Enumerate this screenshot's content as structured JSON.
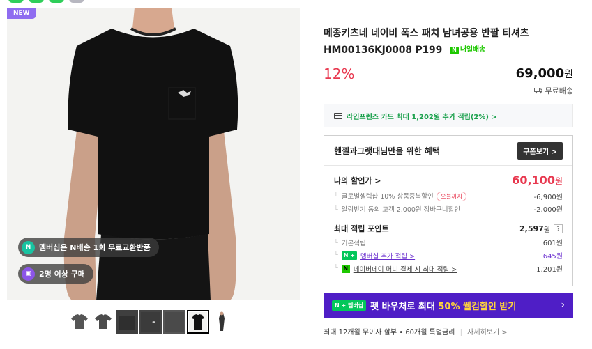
{
  "top_icons": [
    "#2fce5a",
    "#2fce5a",
    "#2fce5a",
    "#b7b7c0"
  ],
  "gallery": {
    "new_badge": "NEW",
    "chips": [
      {
        "icon": "n-exchange-icon",
        "label": "멤버십은 N배송 1회 무료교환반품"
      },
      {
        "icon": "bag-icon",
        "label": "2명 이상 구매"
      }
    ],
    "thumbnails_count": 7,
    "selected_thumbnail": 6
  },
  "product": {
    "title": "메종키츠네 네이비 폭스 패치 남녀공용 반팔 티셔츠 HM00136KJ0008 P199",
    "delivery_badge": "내일배송",
    "discount": "12%",
    "price": "69,000",
    "currency": "원",
    "shipping": "무료배송"
  },
  "card_promo": "라인프렌즈 카드 최대 1,202원 추가 적립(2%) >",
  "benefit": {
    "title": "헨젤과그랫대님만을 위한 혜택",
    "coupon_button": "쿠폰보기 >",
    "my_discount_label": "나의 할인가 >",
    "my_discount_value": "60,100",
    "my_discount_unit": "원",
    "discount_items": [
      {
        "label": "글로벌셀렉샵 10% 상품중복할인",
        "tag": "오늘까지",
        "value": "-6,900원"
      },
      {
        "label": "알림받기 동의 고객 2,000원 장바구니할인",
        "tag": "",
        "value": "-2,000원"
      }
    ],
    "points_label": "최대 적립 포인트",
    "points_value": "2,597",
    "points_unit": "원",
    "points_help": "?",
    "point_items": [
      {
        "label": "기본적립",
        "value": "601원"
      },
      {
        "badge": "N +",
        "label": "멤버십 추가 적립 >",
        "value": "645원"
      },
      {
        "badge": "N",
        "label": "네이버페이 머니 결제 시 최대 적립 >",
        "value": "1,201원"
      }
    ]
  },
  "banner": {
    "badge": "N + 멤버십",
    "text_prefix": "펫 바우처로 최대 ",
    "text_highlight": "50% 웰컴할인 받기",
    "arrow": "›"
  },
  "installment": {
    "text": "최대 12개월 무이자 할부 • 60개월 특별금리",
    "more": "자세히보기 >"
  }
}
